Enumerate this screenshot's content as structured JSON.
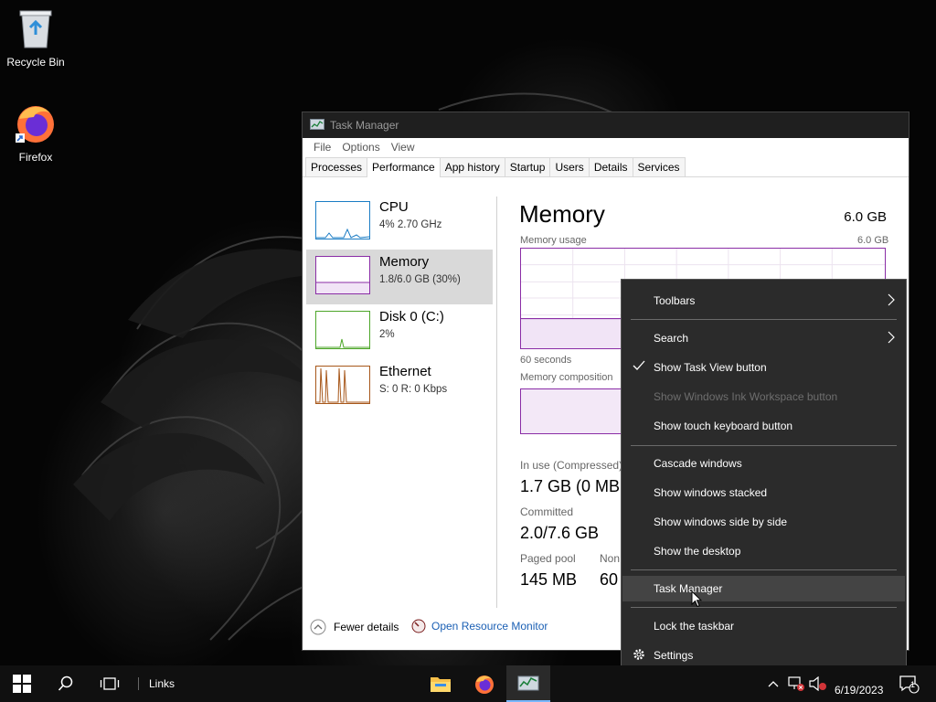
{
  "desktop": {
    "icons": [
      {
        "label": "Recycle Bin"
      },
      {
        "label": "Firefox"
      }
    ]
  },
  "task_manager": {
    "title": "Task Manager",
    "menu": [
      "File",
      "Options",
      "View"
    ],
    "tabs": [
      "Processes",
      "Performance",
      "App history",
      "Startup",
      "Users",
      "Details",
      "Services"
    ],
    "active_tab": "Performance",
    "resources": [
      {
        "name": "CPU",
        "detail": "4%  2.70 GHz",
        "color": "#1a7cc4"
      },
      {
        "name": "Memory",
        "detail": "1.8/6.0 GB (30%)",
        "color": "#8a2da6"
      },
      {
        "name": "Disk 0 (C:)",
        "detail": "2%",
        "color": "#4da629"
      },
      {
        "name": "Ethernet",
        "detail": "S: 0  R: 0 Kbps",
        "color": "#a7571a"
      }
    ],
    "memory": {
      "title": "Memory",
      "total": "6.0 GB",
      "usage_label": "Memory usage",
      "usage_max": "6.0 GB",
      "time_label": "60 seconds",
      "composition_label": "Memory composition",
      "in_use_label": "In use (Compressed)",
      "in_use_value": "1.7 GB (0 MB",
      "committed_label": "Committed",
      "committed_value": "2.0/7.6 GB",
      "paged_pool_label": "Paged pool",
      "paged_pool_value": "145 MB",
      "non_paged_label": "Non",
      "non_paged_value": "60"
    },
    "footer": {
      "fewer_details": "Fewer details",
      "resource_monitor": "Open Resource Monitor"
    }
  },
  "context_menu": {
    "items": [
      {
        "label": "Toolbars",
        "submenu": true
      },
      {
        "label": "Search",
        "submenu": true
      },
      {
        "label": "Show Task View button",
        "checked": true
      },
      {
        "label": "Show Windows Ink Workspace button",
        "disabled": true
      },
      {
        "label": "Show touch keyboard button"
      },
      {
        "label": "Cascade windows"
      },
      {
        "label": "Show windows stacked"
      },
      {
        "label": "Show windows side by side"
      },
      {
        "label": "Show the desktop"
      },
      {
        "label": "Task Manager",
        "highlighted": true
      },
      {
        "label": "Lock the taskbar"
      },
      {
        "label": "Settings",
        "icon": "gear-icon"
      }
    ]
  },
  "taskbar": {
    "links_label": "Links",
    "date": "6/19/2023",
    "notification_count": "1"
  }
}
